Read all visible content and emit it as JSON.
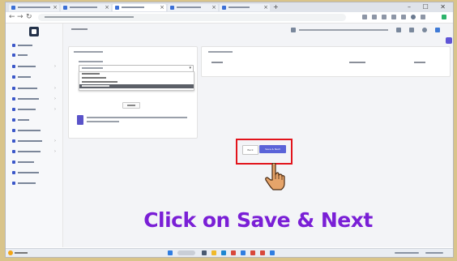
{
  "browser": {
    "tabs": [
      {
        "icon": "page-icon",
        "active": false
      },
      {
        "icon": "page-icon",
        "active": false
      },
      {
        "icon": "page-icon",
        "active": true
      },
      {
        "icon": "page-icon",
        "active": false
      },
      {
        "icon": "page-icon",
        "active": false
      }
    ],
    "window_controls": "– ☐ ✕"
  },
  "toolbar_icons": [
    "star-icon",
    "extensions-icon",
    "profile-icon",
    "menu-icon"
  ],
  "sidebar": {
    "logo": "app-logo",
    "items": [
      {
        "icon": "dashboard-icon",
        "has_submenu": false
      },
      {
        "icon": "users-icon",
        "has_submenu": false
      },
      {
        "icon": "masters-icon",
        "has_submenu": true
      },
      {
        "icon": "list-icon",
        "has_submenu": false
      },
      {
        "icon": "settings-icon",
        "has_submenu": true
      },
      {
        "icon": "report-icon",
        "has_submenu": true
      },
      {
        "icon": "folder-icon",
        "has_submenu": true
      },
      {
        "icon": "calendar-icon",
        "has_submenu": false
      },
      {
        "icon": "chart-icon",
        "has_submenu": false
      },
      {
        "icon": "document-icon",
        "has_submenu": true
      },
      {
        "icon": "tools-icon",
        "has_submenu": true
      },
      {
        "icon": "mail-icon",
        "has_submenu": false
      },
      {
        "icon": "help-icon",
        "has_submenu": false
      },
      {
        "icon": "info-icon",
        "has_submenu": false
      }
    ]
  },
  "main": {
    "buttons": {
      "back_label": "Back",
      "save_label": "Save & Next"
    },
    "dropdown_selected_index": 3
  },
  "caption": "Click on Save & Next",
  "colors": {
    "accent": "#5a63d8",
    "highlight": "#e2141c",
    "caption": "#7a1fd6"
  },
  "taskbar": {
    "icons": [
      "windows-icon",
      "search-icon",
      "taskview-icon",
      "explorer-icon",
      "edge-icon",
      "chrome-icon",
      "store-icon",
      "mail-icon"
    ]
  }
}
